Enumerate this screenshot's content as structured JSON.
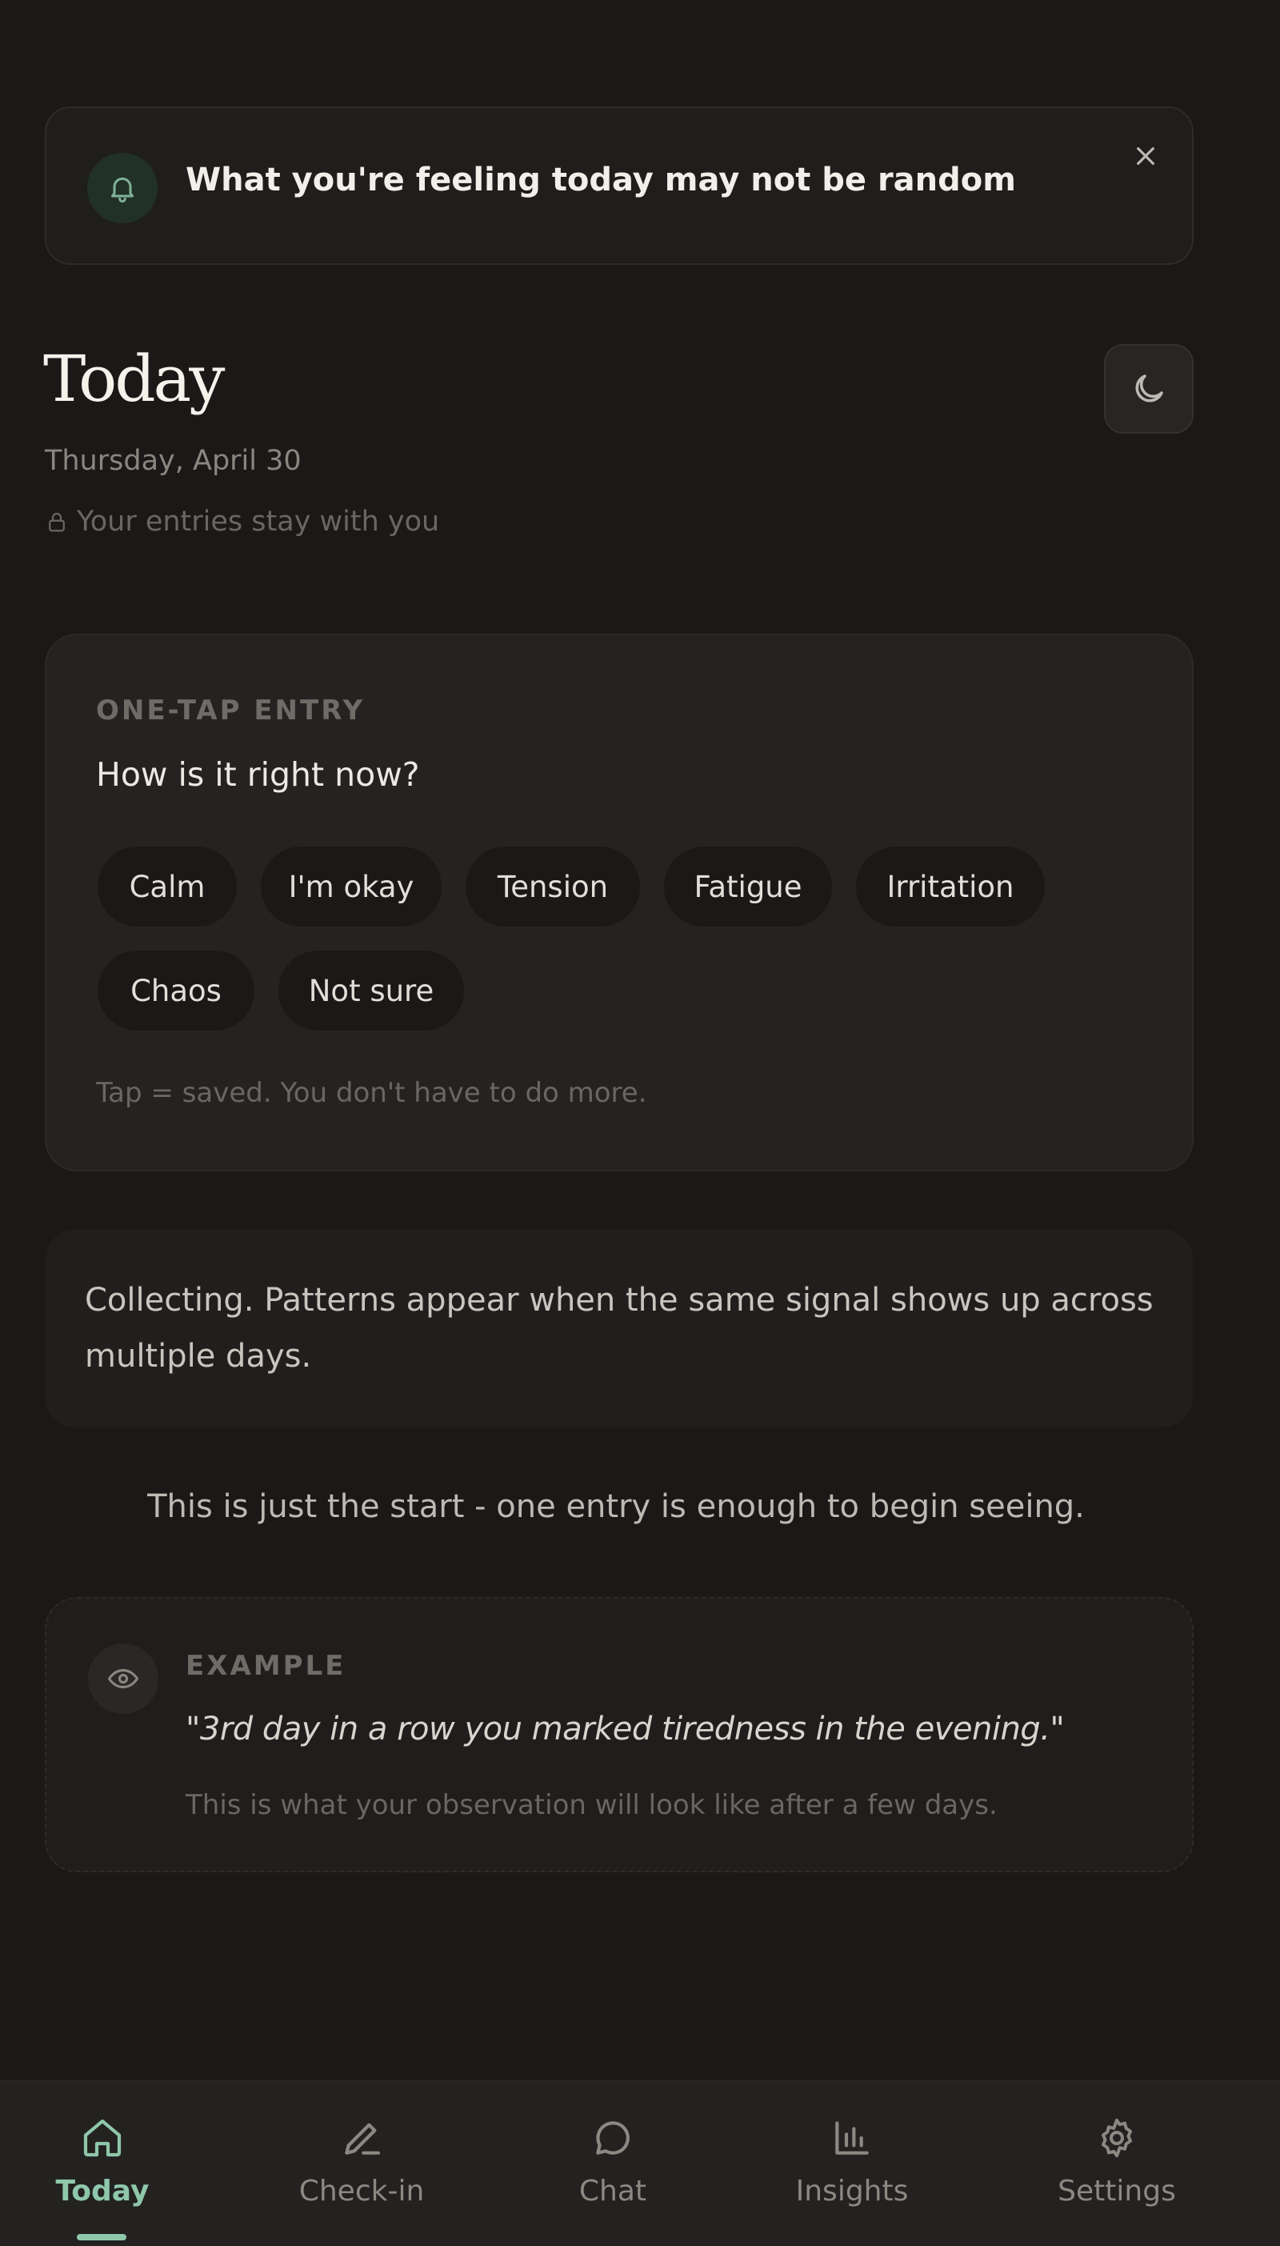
{
  "banner": {
    "message": "What you're feeling today may not be random",
    "bell_icon": "bell-icon",
    "close_icon": "close-icon"
  },
  "header": {
    "title": "Today",
    "date": "Thursday, April 30",
    "privacy_note": "Your entries stay with you",
    "theme_icon": "moon-icon"
  },
  "entry": {
    "eyebrow": "ONE-TAP ENTRY",
    "question": "How is it right now?",
    "chips": [
      "Calm",
      "I'm okay",
      "Tension",
      "Fatigue",
      "Irritation",
      "Chaos",
      "Not sure"
    ],
    "hint": "Tap = saved. You don't have to do more."
  },
  "collecting": {
    "text": "Collecting. Patterns appear when the same signal shows up across multiple days."
  },
  "start_line": "This is just the start - one entry is enough to begin seeing.",
  "example": {
    "eyebrow": "EXAMPLE",
    "quote": "\"3rd day in a row you marked tiredness in the evening.\"",
    "note": "This is what your observation will look like after a few days."
  },
  "nav": {
    "items": [
      {
        "label": "Today",
        "icon": "home-icon",
        "active": true
      },
      {
        "label": "Check-in",
        "icon": "pen-icon",
        "active": false
      },
      {
        "label": "Chat",
        "icon": "chat-bubble-icon",
        "active": false
      },
      {
        "label": "Insights",
        "icon": "bar-chart-icon",
        "active": false
      },
      {
        "label": "Settings",
        "icon": "gear-icon",
        "active": false
      }
    ]
  },
  "colors": {
    "background": "#1a1918",
    "accent": "#8fc7aa",
    "card": "#252322"
  }
}
